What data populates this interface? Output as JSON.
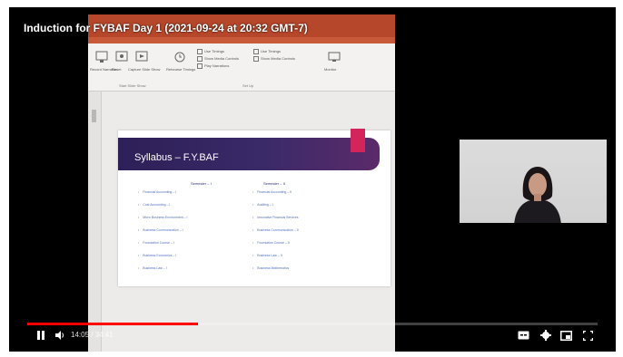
{
  "video": {
    "title": "Induction for FYBAF Day 1 (2021-09-24 at 20:32 GMT-7)",
    "time_display": "14:05 / 34:41",
    "progress": 0.3
  },
  "ribbon": {
    "buttons": [
      "Record Narration",
      "Reset",
      "Capture Slide Show",
      "Rehearse Timings",
      "Set Up Slide Show",
      "Monitor"
    ],
    "checks": [
      "Use Timings",
      "Show Media Controls",
      "Play Narrations",
      "Use Timings",
      "Show Media Controls"
    ],
    "group_labels": [
      "Start Slide Show",
      "Set Up"
    ]
  },
  "slide": {
    "title": "Syllabus – F.Y.BAF",
    "col1_header": "Semester – I",
    "col2_header": "Semester – II",
    "col1": [
      "Financial Accounting – I",
      "Cost Accounting – I",
      "Micro Business Environment – I",
      "Business Communication – I",
      "Foundation Course – I",
      "Business Economics – I",
      "Business Law – I"
    ],
    "col2": [
      "Financial Accounting – II",
      "Auditing – I",
      "Innovative Financial Services",
      "Business Communication – II",
      "Foundation Course – II",
      "Business Law – II",
      "Business Mathematics"
    ]
  },
  "colors": {
    "brand_red": "#ff0000",
    "ppt_orange": "#b7472a",
    "slide_banner": "#2d1f57",
    "slide_accent": "#d4245c"
  }
}
